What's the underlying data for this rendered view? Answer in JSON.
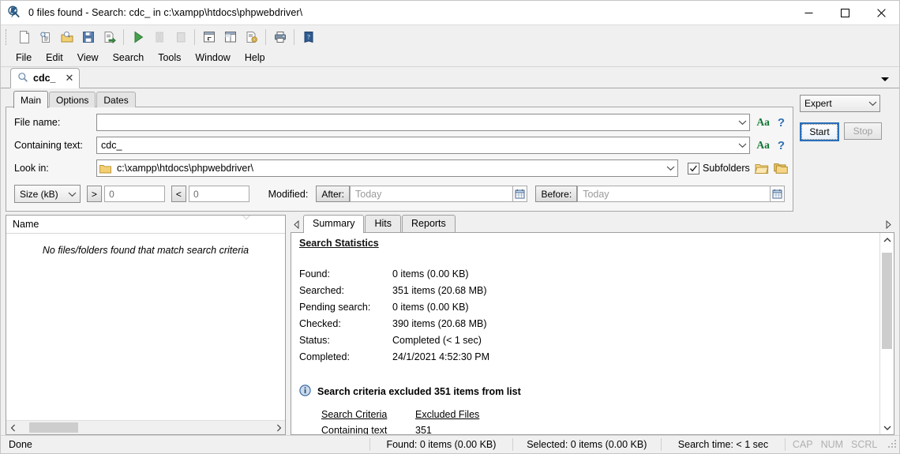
{
  "window": {
    "title": "0 files found - Search: cdc_ in c:\\xampp\\htdocs\\phpwebdriver\\",
    "app_icon": "search-app-icon",
    "minimize": "–",
    "maximize": "□",
    "close": "✕"
  },
  "toolbar": {
    "buttons": [
      {
        "name": "new-search-icon",
        "label": "New"
      },
      {
        "name": "open-search-icon",
        "label": "Open search"
      },
      {
        "name": "load-criteria-icon",
        "label": "Load criteria"
      },
      {
        "name": "save-icon",
        "label": "Save"
      },
      {
        "name": "export-icon",
        "label": "Export"
      },
      {
        "name": "start-search-icon",
        "label": "Start"
      },
      {
        "name": "pause-search-icon",
        "label": "Pause"
      },
      {
        "name": "stop-search-icon",
        "label": "Stop"
      },
      {
        "name": "layout-panel-icon",
        "label": "Panel layout"
      },
      {
        "name": "layout-split-icon",
        "label": "Split layout"
      },
      {
        "name": "report-settings-icon",
        "label": "Report settings"
      },
      {
        "name": "print-icon",
        "label": "Print"
      },
      {
        "name": "help-book-icon",
        "label": "Help"
      }
    ]
  },
  "menubar": {
    "items": [
      "File",
      "Edit",
      "View",
      "Search",
      "Tools",
      "Window",
      "Help"
    ]
  },
  "doctabs": {
    "tabs": [
      {
        "label": "cdc_",
        "icon": "magnifier-icon",
        "close": "✕"
      }
    ],
    "overflow_icon": "chevron-down-icon"
  },
  "criteria": {
    "tabs": [
      "Main",
      "Options",
      "Dates"
    ],
    "active_tab": "Main",
    "filename": {
      "label": "File name:",
      "value": "",
      "placeholder": "",
      "match_case_label": "Aa",
      "help_label": "?"
    },
    "containing_text": {
      "label": "Containing text:",
      "value": "cdc_",
      "match_case_label": "Aa",
      "help_label": "?"
    },
    "look_in": {
      "label": "Look in:",
      "value": "c:\\xampp\\htdocs\\phpwebdriver\\",
      "folder_icon": "folder-icon",
      "subfolders_label": "Subfolders",
      "subfolders_checked": true,
      "browse_icon": "open-folder-icon",
      "multi_folder_icon": "multi-folder-icon"
    },
    "size": {
      "unit": "Size (kB)",
      "gt_label": ">",
      "gt_value": "0",
      "lt_label": "<",
      "lt_value": "0"
    },
    "modified": {
      "label": "Modified:",
      "after_label": "After:",
      "after_placeholder": "Today",
      "before_label": "Before:",
      "before_placeholder": "Today",
      "calendar_icon": "calendar-icon"
    }
  },
  "actions": {
    "mode": "Expert",
    "start_label": "Start",
    "stop_label": "Stop",
    "stop_disabled": true
  },
  "results": {
    "column_header": "Name",
    "empty_message": "No files/folders found that match search criteria",
    "sort_chevron_icon": "chevron-down-icon",
    "hscroll_left_icon": "chevron-left-icon",
    "hscroll_right_icon": "chevron-right-icon"
  },
  "details": {
    "tabs": [
      "Summary",
      "Hits",
      "Reports"
    ],
    "active_tab": "Summary",
    "nav_left_icon": "triangle-left-icon",
    "nav_right_icon": "triangle-right-icon",
    "heading": "Search Statistics",
    "stats": [
      {
        "key": "Found:",
        "value": "0 items (0.00 KB)"
      },
      {
        "key": "Searched:",
        "value": "351 items (20.68 MB)"
      },
      {
        "key": "Pending search:",
        "value": "0 items (0.00 KB)"
      },
      {
        "key": "Checked:",
        "value": "390 items (20.68 MB)"
      },
      {
        "key": "Status:",
        "value": "Completed (< 1 sec)"
      },
      {
        "key": "Completed:",
        "value": "24/1/2021 4:52:30 PM"
      }
    ],
    "notice": {
      "icon": "info-icon",
      "text": "Search criteria excluded 351 items from list"
    },
    "excluded_table": {
      "headers": [
        "Search Criteria",
        "Excluded Files"
      ],
      "rows": [
        [
          "Containing text",
          "351"
        ]
      ]
    },
    "scroll_up_icon": "chevron-up-icon",
    "scroll_down_icon": "chevron-down-icon"
  },
  "statusbar": {
    "state": "Done",
    "found": "Found: 0 items (0.00 KB)",
    "selected": "Selected: 0 items (0.00 KB)",
    "search_time": "Search time: < 1 sec",
    "indicators": [
      "CAP",
      "NUM",
      "SCRL"
    ]
  },
  "colors": {
    "accent": "#2a6fba",
    "match_case": "#117733",
    "help": "#2f6fb5",
    "folder": "#f5c964",
    "play": "#2f8f3f"
  }
}
